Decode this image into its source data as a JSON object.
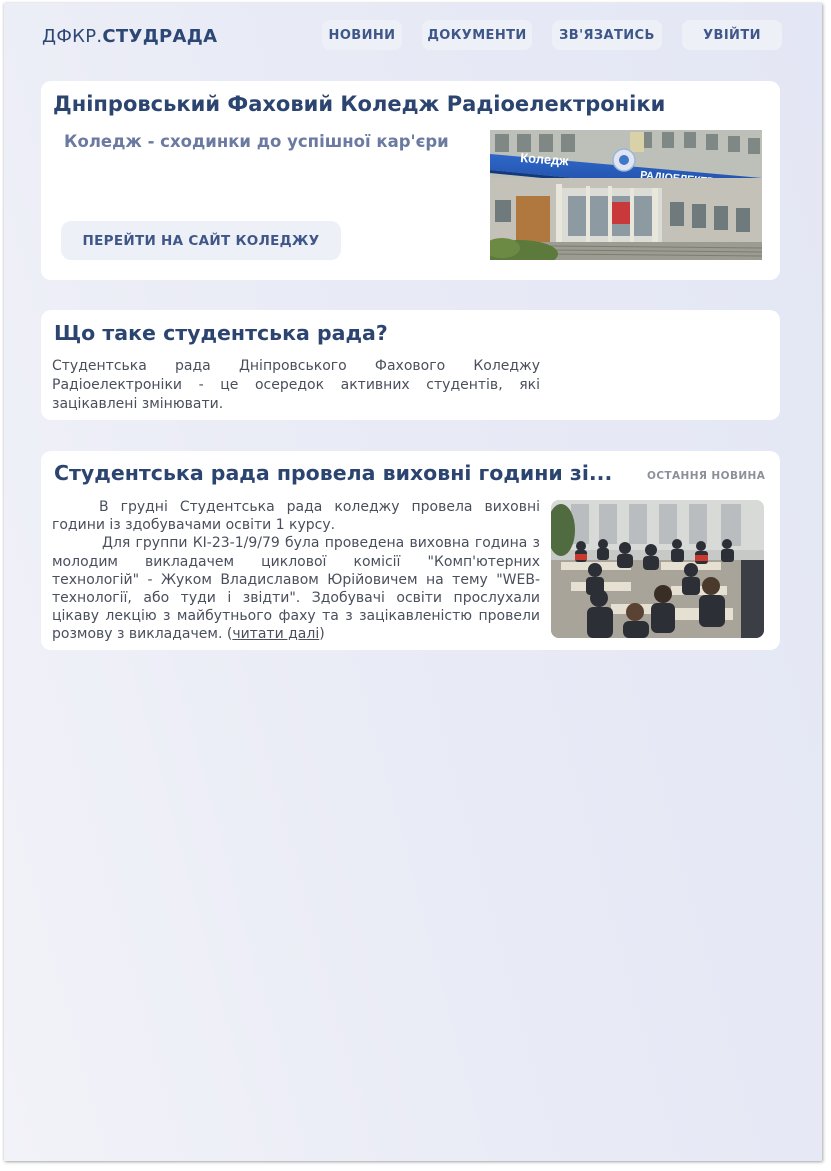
{
  "header": {
    "logo_prefix": "ДФКР.",
    "logo_name": "СТУДРАДА",
    "nav": {
      "news": "НОВИНИ",
      "documents": "ДОКУМЕНТИ",
      "contact": "ЗВ'ЯЗАТИСЬ",
      "login": "УВІЙТИ"
    }
  },
  "hero": {
    "title": "Дніпровський Фаховий Коледж Радіоелектроніки",
    "subtitle": "Коледж - сходинки до успішної кар'єри",
    "button_label": "ПЕРЕЙТИ НА САЙТ КОЛЕДЖУ",
    "photo": {
      "sign_word_1": "Коледж",
      "sign_word_2": "РАДІОЕЛЕКТРОНІКИ"
    }
  },
  "about": {
    "title": "Що таке студентська рада?",
    "text": "Студентська рада Дніпровського Фахового Коледжу Радіоелектроніки - це осередок активних студентів, які зацікавлені змінювати."
  },
  "news": {
    "title": "Студентська рада провела виховні години зі...",
    "tag": "ОСТАННЯ НОВИНА",
    "paragraph_1": "В грудні Студентська рада коледжу провела виховні години із здобувачами освіти 1 курсу.",
    "paragraph_2": "Для группи КІ-23-1/9/79 була проведена виховна година з молодим викладачем циклової комісії \"Комп'ютерних технологій\" - Жуком Владиславом Юрійовичем на тему \"WEB-технології, або туди і звідти\". Здобувачі освіти прослухали цікаву лекцію з майбутнього фаху та з зацікавленістю провели розмову з викладачем. (",
    "read_more": "читати далі",
    "closing": ")"
  }
}
